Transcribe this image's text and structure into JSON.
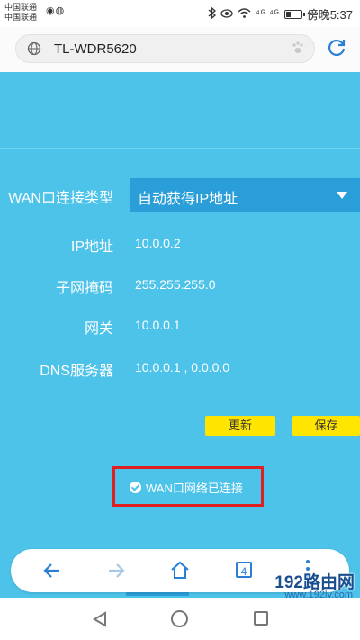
{
  "statusbar": {
    "carrier1": "中国联通",
    "carrier2": "中国联通",
    "app_icons": "◉◍",
    "network": "⁴ᴳ ⁴ᴳ",
    "time": "傍晚5:37"
  },
  "browser": {
    "url": "TL-WDR5620"
  },
  "wan": {
    "type_label": "WAN口连接类型",
    "type_value": "自动获得IP地址",
    "ip_label": "IP地址",
    "ip_value": "10.0.0.2",
    "mask_label": "子网掩码",
    "mask_value": "255.255.255.0",
    "gateway_label": "网关",
    "gateway_value": "10.0.0.1",
    "dns_label": "DNS服务器",
    "dns_value": "10.0.0.1 , 0.0.0.0"
  },
  "buttons": {
    "refresh": "更新",
    "save": "保存"
  },
  "status": {
    "connected": "WAN口网络已连接"
  },
  "toolbar": {
    "tab_count": "4"
  },
  "watermark": {
    "main": "192路由网",
    "sub": "www.192ly.com"
  },
  "colors": {
    "page_bg": "#4ec3ea",
    "select_bg": "#2a9ed8",
    "button_bg": "#ffe500",
    "highlight_border": "#e02020",
    "toolbar_icon": "#2a7fd4"
  }
}
